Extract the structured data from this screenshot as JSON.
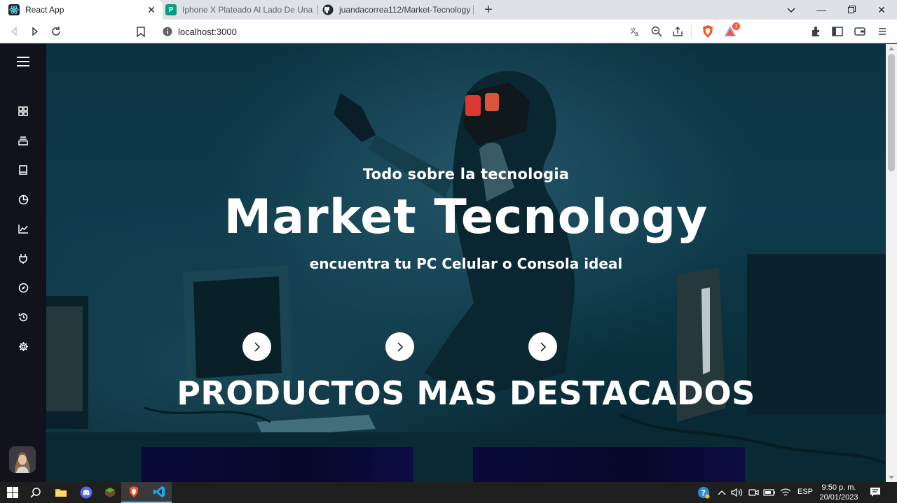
{
  "browser": {
    "tabs": [
      {
        "title": "React App",
        "active": true
      },
      {
        "title": "Iphone X Plateado Al Lado De Una Pla",
        "active": false
      },
      {
        "title": "juandacorrea112/Market-Tecnology",
        "active": false
      }
    ],
    "address": "localhost:3000",
    "brave_badge": "3",
    "colors": {
      "accent": "#fb542b"
    }
  },
  "sidebar": {
    "items": [
      {
        "icon": "menu-icon"
      },
      {
        "icon": "dashboard-icon"
      },
      {
        "icon": "stack-icon"
      },
      {
        "icon": "book-icon"
      },
      {
        "icon": "pie-chart-icon"
      },
      {
        "icon": "line-chart-icon"
      },
      {
        "icon": "plug-icon"
      },
      {
        "icon": "compass-icon"
      },
      {
        "icon": "history-icon"
      },
      {
        "icon": "settings-icon"
      }
    ]
  },
  "hero": {
    "kicker": "Todo sobre la tecnologia",
    "title": "Market Tecnology",
    "subtitle": "encuentra tu PC Celular o Consola ideal",
    "section_title": "PRODUCTOS MAS DESTACADOS"
  },
  "taskbar": {
    "language": "ESP",
    "time": "9:50 p. m.",
    "date": "20/01/2023"
  }
}
